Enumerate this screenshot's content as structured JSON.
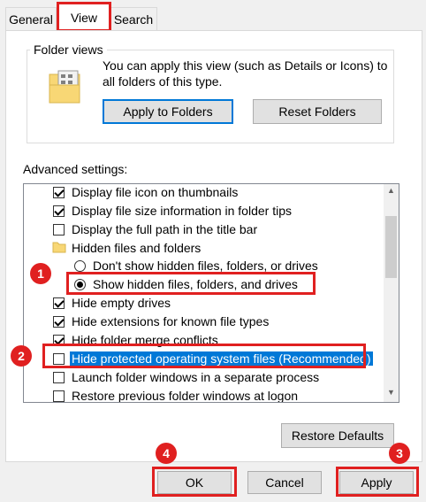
{
  "tabs": [
    "General",
    "View",
    "Search"
  ],
  "folder_views": {
    "label": "Folder views",
    "description_line1": "You can apply this view (such as Details or Icons) to",
    "description_line2": "all folders of this type.",
    "apply_button": "Apply to Folders",
    "reset_button": "Reset Folders"
  },
  "advanced": {
    "label": "Advanced settings:",
    "items": [
      {
        "type": "checkbox",
        "checked": true,
        "label": "Display file icon on thumbnails"
      },
      {
        "type": "checkbox",
        "checked": true,
        "label": "Display file size information in folder tips"
      },
      {
        "type": "checkbox",
        "checked": false,
        "label": "Display the full path in the title bar"
      },
      {
        "type": "folder",
        "label": "Hidden files and folders"
      },
      {
        "type": "radio",
        "checked": false,
        "label": "Don't show hidden files, folders, or drives"
      },
      {
        "type": "radio",
        "checked": true,
        "label": "Show hidden files, folders, and drives"
      },
      {
        "type": "checkbox",
        "checked": true,
        "label": "Hide empty drives"
      },
      {
        "type": "checkbox",
        "checked": true,
        "label": "Hide extensions for known file types"
      },
      {
        "type": "checkbox",
        "checked": true,
        "label": "Hide folder merge conflicts"
      },
      {
        "type": "checkbox",
        "checked": false,
        "label": "Hide protected operating system files (Recommended)",
        "selected": true
      },
      {
        "type": "checkbox",
        "checked": false,
        "label": "Launch folder windows in a separate process"
      },
      {
        "type": "checkbox",
        "checked": false,
        "label": "Restore previous folder windows at logon"
      }
    ],
    "restore_button": "Restore Defaults"
  },
  "footer": {
    "ok": "OK",
    "cancel": "Cancel",
    "apply": "Apply"
  },
  "badges": [
    "1",
    "2",
    "3",
    "4"
  ],
  "colors": {
    "highlight": "#e02020",
    "selection": "#0078d7"
  }
}
